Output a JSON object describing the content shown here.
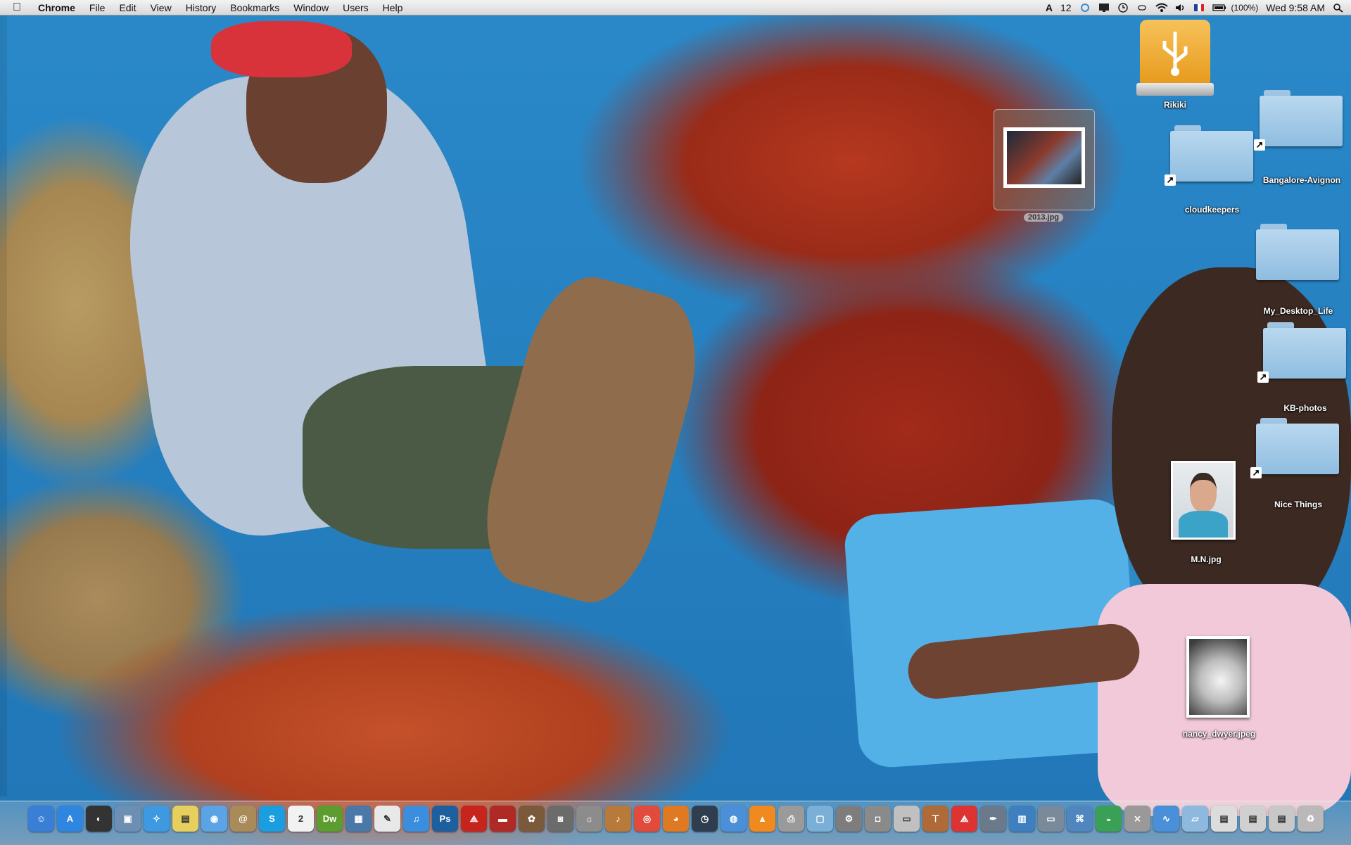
{
  "menubar": {
    "app_name": "Chrome",
    "items": [
      "File",
      "Edit",
      "View",
      "History",
      "Bookmarks",
      "Window",
      "Users",
      "Help"
    ],
    "status": {
      "keyboard_count": "12",
      "battery": "(100%)",
      "clock": "Wed 9:58 AM"
    }
  },
  "desktop_icons": {
    "drive": {
      "label": "Rikiki",
      "icon": "usb-drive-icon"
    },
    "image_2013": {
      "label": "2013.jpg",
      "icon": "image-file-icon"
    },
    "cloudkeepers": {
      "label": "cloudkeepers",
      "icon": "folder-alias-icon"
    },
    "bangalore": {
      "label": "Bangalore-Avignon",
      "icon": "folder-alias-icon"
    },
    "my_desktop_life": {
      "label": "My_Desktop_Life",
      "icon": "folder-icon"
    },
    "kb_photos": {
      "label": "KB-photos",
      "icon": "folder-alias-icon"
    },
    "nice_things": {
      "label": "Nice Things",
      "icon": "folder-alias-icon"
    },
    "mn_jpg": {
      "label": "M.N.jpg",
      "icon": "portrait-image-icon"
    },
    "nancy": {
      "label": "nancy_dwyer.jpeg",
      "icon": "image-file-icon"
    }
  },
  "dock": {
    "items": [
      {
        "name": "finder-icon",
        "glyph": "☺",
        "color": "#3a7fd6"
      },
      {
        "name": "app-store-icon",
        "glyph": "A",
        "color": "#2f86e0"
      },
      {
        "name": "dashboard-icon",
        "glyph": "◐",
        "color": "#333333"
      },
      {
        "name": "preview-icon",
        "glyph": "▣",
        "color": "#6d8fb3"
      },
      {
        "name": "safari-icon",
        "glyph": "✧",
        "color": "#3e9ae0"
      },
      {
        "name": "stickies-icon",
        "glyph": "▤",
        "color": "#e6cf5c"
      },
      {
        "name": "ichat-icon",
        "glyph": "◉",
        "color": "#5aa4e6"
      },
      {
        "name": "address-book-icon",
        "glyph": "@",
        "color": "#a88b59"
      },
      {
        "name": "skype-icon",
        "glyph": "S",
        "color": "#1a9ee0"
      },
      {
        "name": "calendar-icon",
        "glyph": "2",
        "color": "#f2f2f2"
      },
      {
        "name": "dreamweaver-icon",
        "glyph": "Dw",
        "color": "#5d9c2f"
      },
      {
        "name": "photo-browser-icon",
        "glyph": "▦",
        "color": "#4a78a8"
      },
      {
        "name": "textedit-icon",
        "glyph": "✎",
        "color": "#e8e8e8"
      },
      {
        "name": "itunes-icon",
        "glyph": "♫",
        "color": "#3b8ede"
      },
      {
        "name": "photoshop-icon",
        "glyph": "Ps",
        "color": "#1e5f9e"
      },
      {
        "name": "acrobat-icon",
        "glyph": "⟁",
        "color": "#c7241d"
      },
      {
        "name": "flashcards-icon",
        "glyph": "▬",
        "color": "#b02a25"
      },
      {
        "name": "iphoto-icon",
        "glyph": "✿",
        "color": "#7a5a3b"
      },
      {
        "name": "image-capture-icon",
        "glyph": "◙",
        "color": "#6b6b6b"
      },
      {
        "name": "automator-icon",
        "glyph": "☼",
        "color": "#8c8c8c"
      },
      {
        "name": "garageband-icon",
        "glyph": "♪",
        "color": "#b87a3a"
      },
      {
        "name": "chrome-icon",
        "glyph": "◎",
        "color": "#e24b3b"
      },
      {
        "name": "firefox-icon",
        "glyph": "◕",
        "color": "#e07a22"
      },
      {
        "name": "time-machine-icon",
        "glyph": "◷",
        "color": "#2e3e4e"
      },
      {
        "name": "disk-utility-icon",
        "glyph": "◍",
        "color": "#4a8fd8"
      },
      {
        "name": "vlc-icon",
        "glyph": "▲",
        "color": "#f08a1e"
      },
      {
        "name": "printer-icon",
        "glyph": "⎙",
        "color": "#9a9a9a"
      },
      {
        "name": "filemerge-icon",
        "glyph": "▢",
        "color": "#7ab0d8"
      },
      {
        "name": "system-preferences-icon",
        "glyph": "⚙",
        "color": "#7d7d7d"
      },
      {
        "name": "screenshot-icon",
        "glyph": "◘",
        "color": "#8a8a8a"
      },
      {
        "name": "keynote-icon",
        "glyph": "▭",
        "color": "#c0c0c0"
      },
      {
        "name": "presentation-icon",
        "glyph": "⊤",
        "color": "#b06a38"
      },
      {
        "name": "pdf-icon",
        "glyph": "⟁",
        "color": "#d33"
      },
      {
        "name": "script-editor-icon",
        "glyph": "✒",
        "color": "#6a7a8a"
      },
      {
        "name": "activity-monitor-icon",
        "glyph": "▥",
        "color": "#3d7fbf"
      },
      {
        "name": "remote-desktop-icon",
        "glyph": "▭",
        "color": "#7a8a9a"
      },
      {
        "name": "network-utility-icon",
        "glyph": "⌘",
        "color": "#4f86c0"
      },
      {
        "name": "cyberduck-icon",
        "glyph": "◒",
        "color": "#3aa055"
      },
      {
        "name": "grapher-icon",
        "glyph": "⨯",
        "color": "#999999"
      },
      {
        "name": "migration-icon",
        "glyph": "∿",
        "color": "#4a90d9"
      },
      {
        "name": "applications-stack-icon",
        "glyph": "▱",
        "color": "#8fb8df"
      },
      {
        "name": "documents-stack-icon",
        "glyph": "▤",
        "color": "#dcdcdc"
      },
      {
        "name": "downloads-stack-icon",
        "glyph": "▤",
        "color": "#d0d0d0"
      },
      {
        "name": "stack-icon",
        "glyph": "▤",
        "color": "#c8c8c8"
      },
      {
        "name": "trash-icon",
        "glyph": "♻",
        "color": "#b9b9b9"
      }
    ]
  }
}
